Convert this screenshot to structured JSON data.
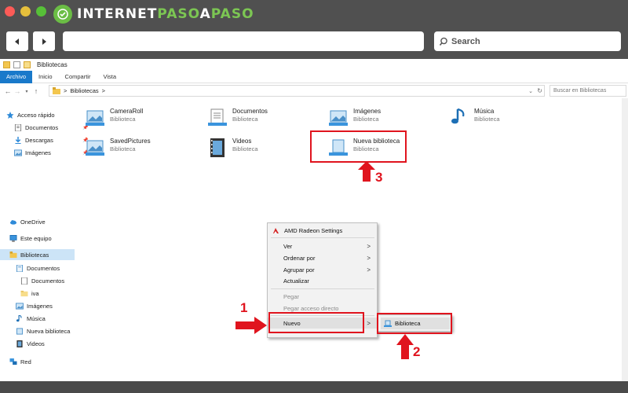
{
  "brand": {
    "part1": "INTERNET",
    "part2": "PASO",
    "part3": "A",
    "part4": "PASO"
  },
  "browser": {
    "search_placeholder": "Search"
  },
  "explorer": {
    "title": "Bibliotecas",
    "tabs": [
      {
        "label": "Archivo",
        "active": true
      },
      {
        "label": "Inicio"
      },
      {
        "label": "Compartir"
      },
      {
        "label": "Vista"
      }
    ],
    "address": {
      "path": "Bibliotecas",
      "sep": ">",
      "search_placeholder": "Buscar en Bibliotecas"
    }
  },
  "navpane": {
    "quick_access": "Acceso rápido",
    "quick_items": [
      "Documentos",
      "Descargas",
      "Imágenes"
    ],
    "onedrive": "OneDrive",
    "this_pc": "Este equipo",
    "libraries": "Bibliotecas",
    "lib_children": [
      "Documentos",
      "Documentos",
      "iva",
      "Imágenes",
      "Música",
      "Nueva biblioteca",
      "Videos"
    ],
    "network": "Red"
  },
  "libraries": [
    {
      "name": "CameraRoll",
      "type": "Biblioteca"
    },
    {
      "name": "Documentos",
      "type": "Biblioteca"
    },
    {
      "name": "Imágenes",
      "type": "Biblioteca"
    },
    {
      "name": "Música",
      "type": "Biblioteca"
    },
    {
      "name": "SavedPictures",
      "type": "Biblioteca"
    },
    {
      "name": "Videos",
      "type": "Biblioteca"
    },
    {
      "name": "Nueva biblioteca",
      "type": "Biblioteca"
    }
  ],
  "context_menu": {
    "amd": "AMD Radeon Settings",
    "ver": "Ver",
    "ordenar": "Ordenar por",
    "agrupar": "Agrupar por",
    "actualizar": "Actualizar",
    "pegar": "Pegar",
    "pegar_acceso": "Pegar acceso directo",
    "nuevo": "Nuevo",
    "submenu_biblioteca": "Biblioteca"
  },
  "annotations": {
    "n1": "1",
    "n2": "2",
    "n3": "3"
  },
  "colors": {
    "accent": "#1979ca",
    "annotation_red": "#e0141e",
    "brand_green": "#6bbd45"
  }
}
